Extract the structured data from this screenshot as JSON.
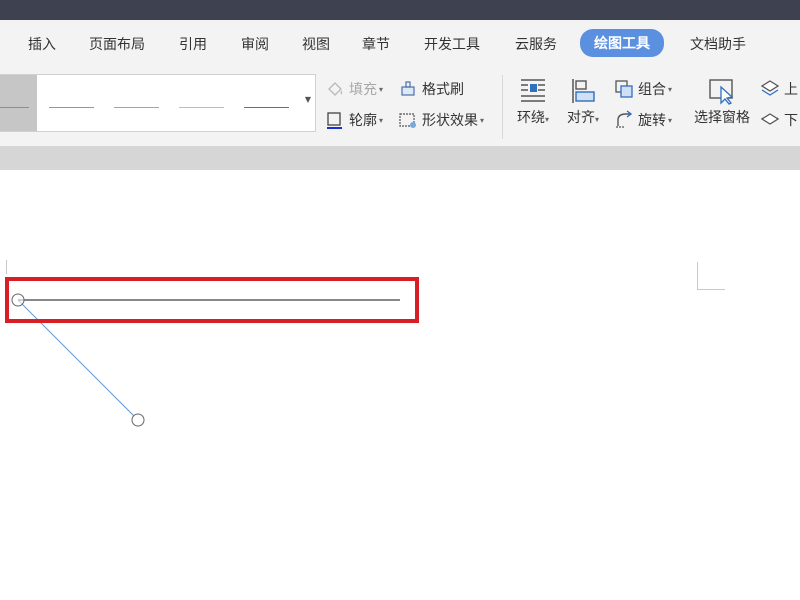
{
  "menu": {
    "tabs": [
      {
        "label": "插入"
      },
      {
        "label": "页面布局"
      },
      {
        "label": "引用"
      },
      {
        "label": "审阅"
      },
      {
        "label": "视图"
      },
      {
        "label": "章节"
      },
      {
        "label": "开发工具"
      },
      {
        "label": "云服务"
      },
      {
        "label": "绘图工具",
        "active": true
      },
      {
        "label": "文档助手"
      }
    ]
  },
  "ribbon": {
    "style_gallery": {
      "line_colors": [
        "#5b9bd5",
        "#ed7d31",
        "#a5a5a5",
        "#ffc000",
        "#4472c4"
      ]
    },
    "fill": {
      "label": "填充",
      "enabled": false
    },
    "outline": {
      "label": "轮廓"
    },
    "format_painter": {
      "label": "格式刷"
    },
    "shape_effects": {
      "label": "形状效果"
    },
    "wrap": {
      "label": "环绕"
    },
    "align": {
      "label": "对齐"
    },
    "group": {
      "label": "组合"
    },
    "rotate": {
      "label": "旋转"
    },
    "selection_pane": {
      "label": "选择窗格"
    },
    "bring_forward": {
      "label": "上"
    },
    "send_backward": {
      "label": "下"
    }
  },
  "colors": {
    "accent": "#5b8fe0",
    "highlight": "#d81f26",
    "titlebar": "#3d4150"
  }
}
